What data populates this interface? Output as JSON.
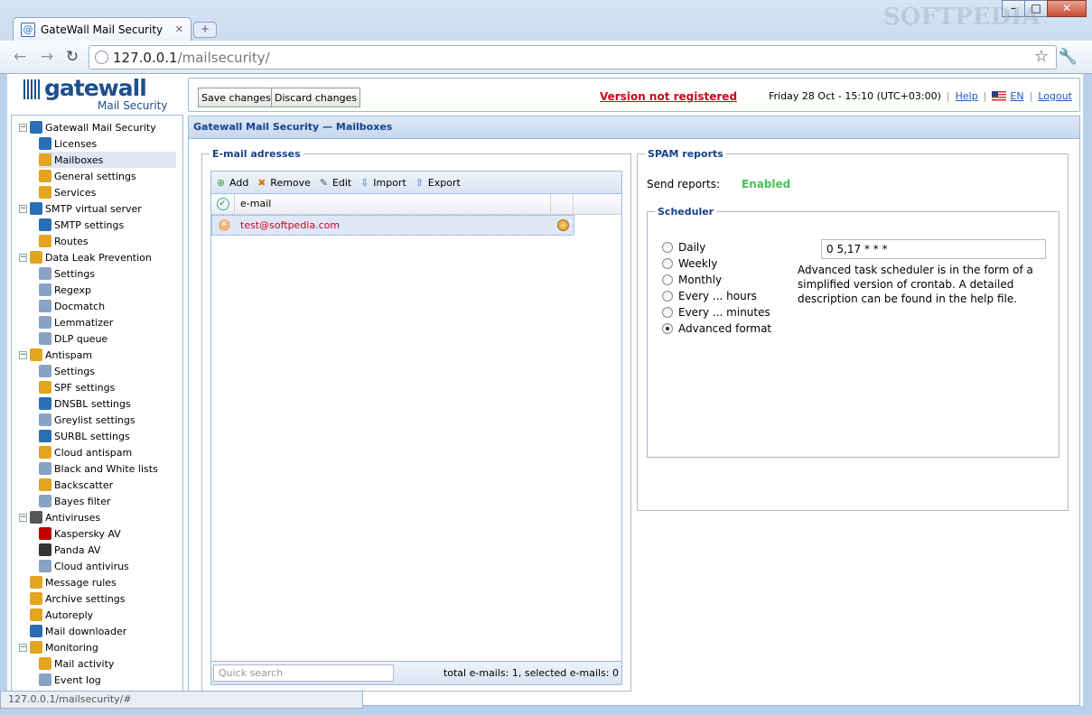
{
  "browser": {
    "tab_title": "GateWall Mail Security",
    "url_host": "127.0.0.1",
    "url_path": "/mailsecurity/",
    "status_url": "127.0.0.1/mailsecurity/#",
    "watermark": "SOFTPEDIA"
  },
  "logo": {
    "name": "gatewall",
    "sub": "Mail Security"
  },
  "topbar": {
    "save_label": "Save changes",
    "discard_label": "Discard changes",
    "not_registered": "Version not registered",
    "datetime": "Friday 28 Oct - 15:10 (UTC+03:00)",
    "help": "Help",
    "lang": "EN",
    "logout": "Logout"
  },
  "sidebar": {
    "items": [
      {
        "label": "Gatewall Mail Security",
        "icon": "app-icon",
        "color": "#2a6fb5"
      },
      {
        "label": "Licenses",
        "icon": "info-icon",
        "color": "#2a6fb5"
      },
      {
        "label": "Mailboxes",
        "icon": "mailbox-icon",
        "color": "#e3a521"
      },
      {
        "label": "General settings",
        "icon": "settings-icon",
        "color": "#e3a521"
      },
      {
        "label": "Services",
        "icon": "services-icon",
        "color": "#e3a521"
      },
      {
        "label": "SMTP virtual server",
        "icon": "at-icon",
        "color": "#2a6fb5"
      },
      {
        "label": "SMTP settings",
        "icon": "at-settings-icon",
        "color": "#2a6fb5"
      },
      {
        "label": "Routes",
        "icon": "routes-icon",
        "color": "#e3a521"
      },
      {
        "label": "Data Leak Prevention",
        "icon": "dlp-icon",
        "color": "#e3a521"
      },
      {
        "label": "Settings",
        "icon": "doc-settings-icon",
        "color": "#8aa3c4"
      },
      {
        "label": "Regexp",
        "icon": "regexp-icon",
        "color": "#8aa3c4"
      },
      {
        "label": "Docmatch",
        "icon": "docmatch-icon",
        "color": "#8aa3c4"
      },
      {
        "label": "Lemmatizer",
        "icon": "lemmatizer-icon",
        "color": "#8aa3c4"
      },
      {
        "label": "DLP queue",
        "icon": "queue-icon",
        "color": "#8aa3c4"
      },
      {
        "label": "Antispam",
        "icon": "antispam-icon",
        "color": "#e3a521"
      },
      {
        "label": "Settings",
        "icon": "settings-icon",
        "color": "#8aa3c4"
      },
      {
        "label": "SPF settings",
        "icon": "spf-icon",
        "color": "#e3a521"
      },
      {
        "label": "DNSBL settings",
        "icon": "dnsbl-icon",
        "color": "#2a6fb5"
      },
      {
        "label": "Greylist settings",
        "icon": "greylist-icon",
        "color": "#8aa3c4"
      },
      {
        "label": "SURBL settings",
        "icon": "surbl-icon",
        "color": "#2a6fb5"
      },
      {
        "label": "Cloud antispam",
        "icon": "cloud-icon",
        "color": "#e3a521"
      },
      {
        "label": "Black and White lists",
        "icon": "list-icon",
        "color": "#8aa3c4"
      },
      {
        "label": "Backscatter",
        "icon": "backscatter-icon",
        "color": "#e3a521"
      },
      {
        "label": "Bayes filter",
        "icon": "bayes-icon",
        "color": "#8aa3c4"
      },
      {
        "label": "Antiviruses",
        "icon": "antivirus-icon",
        "color": "#555555"
      },
      {
        "label": "Kaspersky AV",
        "icon": "kaspersky-icon",
        "color": "#c00000"
      },
      {
        "label": "Panda AV",
        "icon": "panda-icon",
        "color": "#333333"
      },
      {
        "label": "Cloud antivirus",
        "icon": "cloud-icon",
        "color": "#8aa3c4"
      },
      {
        "label": "Message rules",
        "icon": "rules-icon",
        "color": "#e3a521"
      },
      {
        "label": "Archive settings",
        "icon": "archive-icon",
        "color": "#e3a521"
      },
      {
        "label": "Autoreply",
        "icon": "autoreply-icon",
        "color": "#e3a521"
      },
      {
        "label": "Mail downloader",
        "icon": "downloader-icon",
        "color": "#2a6fb5"
      },
      {
        "label": "Monitoring",
        "icon": "monitoring-icon",
        "color": "#e3a521"
      },
      {
        "label": "Mail activity",
        "icon": "activity-icon",
        "color": "#e3a521"
      },
      {
        "label": "Event log",
        "icon": "log-icon",
        "color": "#8aa3c4"
      }
    ]
  },
  "main": {
    "header": "Gatewall Mail Security — Mailboxes",
    "emails_legend": "E-mail adresses",
    "toolbar": {
      "add": "Add",
      "remove": "Remove",
      "edit": "Edit",
      "import": "Import",
      "export": "Export"
    },
    "column_email": "e-mail",
    "rows": [
      {
        "email": "test@softpedia.com"
      }
    ],
    "quick_search_placeholder": "Quick search",
    "total": "total e-mails: 1, selected e-mails: 0",
    "spam_legend": "SPAM reports",
    "send_reports_label": "Send reports:",
    "send_reports_value": "Enabled",
    "scheduler_legend": "Scheduler",
    "schedule_options": [
      "Daily",
      "Weekly",
      "Monthly",
      "Every ... hours",
      "Every ... minutes",
      "Advanced format"
    ],
    "schedule_selected": "Advanced format",
    "cron_value": "0 5,17 * * *",
    "cron_desc": "Advanced task scheduler is in the form of a simplified version of crontab. A detailed description can be found in the help file."
  },
  "colors": {
    "accent": "#15428b",
    "link": "#1b5cb7",
    "alert": "#d0021b",
    "enabled": "#44c553"
  }
}
